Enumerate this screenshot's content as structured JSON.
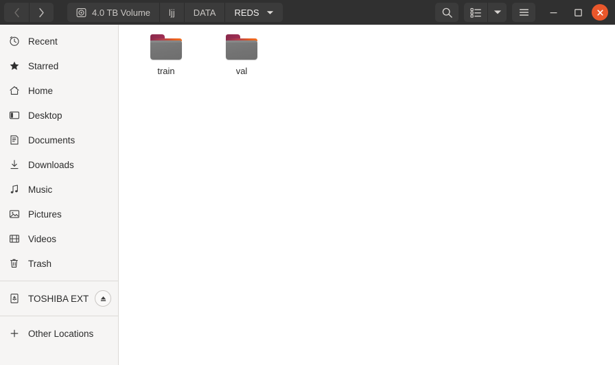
{
  "window": {
    "title": "REDS",
    "accent_color": "#e9572b",
    "header_bg": "#303030",
    "sidebar_bg": "#f6f5f4",
    "main_bg": "#ffffff"
  },
  "navigation": {
    "back_label": "‹",
    "forward_label": "›",
    "back_name": "back-button",
    "forward_name": "forward-button"
  },
  "pathbar": {
    "segments": [
      {
        "label": "4.0 TB Volume",
        "icon": "drive-harddisk-icon",
        "current": false
      },
      {
        "label": "ljj",
        "icon": "",
        "current": false
      },
      {
        "label": "DATA",
        "icon": "",
        "current": false
      },
      {
        "label": "REDS",
        "icon": "",
        "current": true
      }
    ]
  },
  "toolbar": {
    "search_label": "",
    "search_icon": "search-icon",
    "view_list_icon": "view-list-icon",
    "view_dropdown_icon": "chevron-down-icon",
    "menu_icon": "hamburger-menu-icon"
  },
  "window_controls": {
    "minimize_label": "—",
    "maximize_label": "□",
    "close_label": "✕"
  },
  "sidebar": {
    "items": [
      {
        "label": "Recent",
        "icon": "clock-icon"
      },
      {
        "label": "Starred",
        "icon": "star-icon"
      },
      {
        "label": "Home",
        "icon": "home-icon"
      },
      {
        "label": "Desktop",
        "icon": "desktop-icon"
      },
      {
        "label": "Documents",
        "icon": "document-icon"
      },
      {
        "label": "Downloads",
        "icon": "download-icon"
      },
      {
        "label": "Music",
        "icon": "music-note-icon"
      },
      {
        "label": "Pictures",
        "icon": "image-icon"
      },
      {
        "label": "Videos",
        "icon": "film-icon"
      },
      {
        "label": "Trash",
        "icon": "trash-icon"
      }
    ],
    "devices": [
      {
        "label": "TOSHIBA EXT",
        "icon": "usb-drive-icon",
        "eject_icon": "eject-icon"
      }
    ],
    "other": {
      "label": "Other Locations",
      "icon": "plus-icon"
    }
  },
  "main": {
    "files": [
      {
        "label": "train",
        "icon": "folder-icon",
        "type": "folder"
      },
      {
        "label": "val",
        "icon": "folder-icon",
        "type": "folder"
      }
    ]
  }
}
